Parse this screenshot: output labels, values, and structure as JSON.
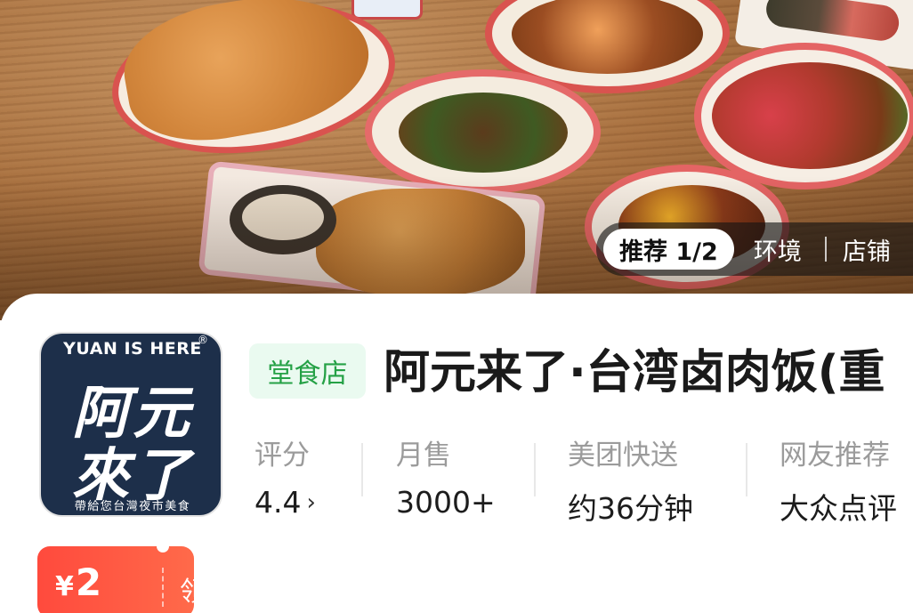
{
  "gallery": {
    "tab_active": "推荐 1/2",
    "tab_environment": "环境",
    "tab_store": "店铺"
  },
  "logo": {
    "brand_en": "YUAN IS HERE",
    "registered": "®",
    "brand_cn_line1": "阿元",
    "brand_cn_line2": "來了",
    "tagline": "帶給您台灣夜市美食"
  },
  "store": {
    "badge": "堂食店",
    "title": "阿元来了·台湾卤肉饭(重"
  },
  "stats": {
    "rating_label": "评分",
    "rating_value": "4.4",
    "sales_label": "月售",
    "sales_value": "3000+",
    "delivery_label": "美团快送",
    "delivery_value": "约36分钟",
    "recommend_label": "网友推荐",
    "recommend_value": "大众点评"
  },
  "coupon": {
    "currency": "¥",
    "amount": "2",
    "claim_label": "领"
  },
  "colors": {
    "accent_red": "#ff4a3d",
    "badge_green": "#25a146",
    "logo_navy": "#1d2f4a"
  }
}
